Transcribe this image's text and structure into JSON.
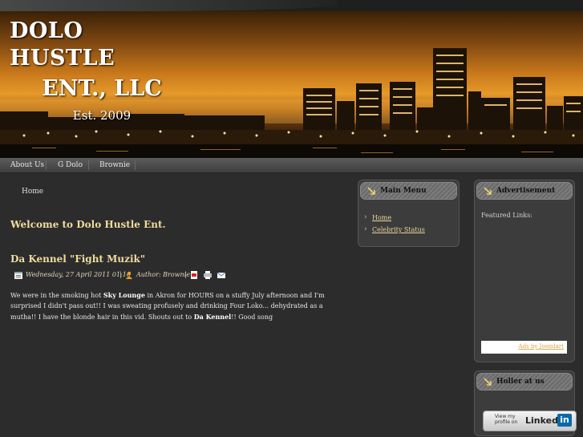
{
  "site": {
    "name_line1": "DOLO HUSTLE",
    "name_line2": "ENT., LLC",
    "established": "Est. 2009"
  },
  "nav": {
    "items": [
      "About Us",
      "G Dolo",
      "Brownie"
    ]
  },
  "breadcrumb": "Home",
  "page_title": "Welcome to Dolo Hustle Ent.",
  "article": {
    "title": "Da Kennel \"Fight Muzik\"",
    "date": "Wednesday, 27 April 2011 01:16",
    "author": "Author: Brownie",
    "separator": "|",
    "body_part1": "We were in the smoking hot ",
    "body_bold1": "Sky Lounge",
    "body_part2": " in Akron for HOURS on a stuffy July afternoon and I'm surprised I didn't pass out!!  I was sweating profusely and drinking Four Loko... dehydrated as a mutha!!  I have the blonde hair in this vid.  Shouts out to ",
    "body_bold2": "Da Kennel",
    "body_part3": "!!  Good song"
  },
  "main_menu": {
    "title": "Main Menu",
    "items": [
      "Home",
      "Celebrity Status"
    ]
  },
  "advertisement": {
    "title": "Advertisement",
    "featured": "Featured Links:",
    "ads_link": "Ads by Joomlart"
  },
  "holler": {
    "title": "Holler at us",
    "badge_line1": "View my",
    "badge_line2": "profile on",
    "badge_brand": "Linked",
    "badge_in": "in"
  },
  "colors": {
    "accent": "#f0dc9e",
    "link": "#e9d49a",
    "background": "#2c2c2c"
  }
}
